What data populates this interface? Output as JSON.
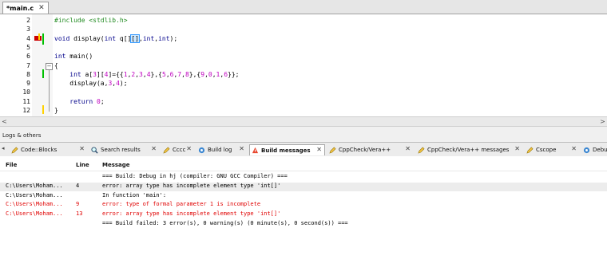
{
  "editor_tab": {
    "label": "*main.c",
    "close": "✕"
  },
  "editor": {
    "lines": [
      {
        "num": "2",
        "segments": [
          {
            "t": "#include <stdlib.h>",
            "c": "pp"
          }
        ]
      },
      {
        "num": "3",
        "segments": []
      },
      {
        "num": "4",
        "segments": [
          {
            "t": "void ",
            "c": "kw"
          },
          {
            "t": "display(",
            "c": ""
          },
          {
            "t": "int",
            "c": "kw"
          },
          {
            "t": " q[]",
            "c": ""
          },
          {
            "t": "[]",
            "c": "cb"
          },
          {
            "t": ",",
            "c": ""
          },
          {
            "t": "int",
            "c": "kw"
          },
          {
            "t": ",",
            "c": ""
          },
          {
            "t": "int",
            "c": "kw"
          },
          {
            "t": ");",
            "c": ""
          }
        ]
      },
      {
        "num": "5",
        "segments": []
      },
      {
        "num": "6",
        "segments": [
          {
            "t": "int ",
            "c": "kw"
          },
          {
            "t": "main()",
            "c": ""
          }
        ]
      },
      {
        "num": "7",
        "segments": [
          {
            "t": "{",
            "c": ""
          }
        ]
      },
      {
        "num": "8",
        "segments": [
          {
            "t": "    int ",
            "c": "kw"
          },
          {
            "t": "a[",
            "c": ""
          },
          {
            "t": "3",
            "c": "num"
          },
          {
            "t": "][",
            "c": ""
          },
          {
            "t": "4",
            "c": "num"
          },
          {
            "t": "]={{",
            "c": ""
          },
          {
            "t": "1",
            "c": "num"
          },
          {
            "t": ",",
            "c": ""
          },
          {
            "t": "2",
            "c": "num"
          },
          {
            "t": ",",
            "c": ""
          },
          {
            "t": "3",
            "c": "num"
          },
          {
            "t": ",",
            "c": ""
          },
          {
            "t": "4",
            "c": "num"
          },
          {
            "t": "},{",
            "c": ""
          },
          {
            "t": "5",
            "c": "num"
          },
          {
            "t": ",",
            "c": ""
          },
          {
            "t": "6",
            "c": "num"
          },
          {
            "t": ",",
            "c": ""
          },
          {
            "t": "7",
            "c": "num"
          },
          {
            "t": ",",
            "c": ""
          },
          {
            "t": "8",
            "c": "num"
          },
          {
            "t": "},{",
            "c": ""
          },
          {
            "t": "9",
            "c": "num"
          },
          {
            "t": ",",
            "c": ""
          },
          {
            "t": "0",
            "c": "num"
          },
          {
            "t": ",",
            "c": ""
          },
          {
            "t": "1",
            "c": "num"
          },
          {
            "t": ",",
            "c": ""
          },
          {
            "t": "6",
            "c": "num"
          },
          {
            "t": "}};",
            "c": ""
          }
        ]
      },
      {
        "num": "9",
        "segments": [
          {
            "t": "    display(a,",
            "c": ""
          },
          {
            "t": "3",
            "c": "num"
          },
          {
            "t": ",",
            "c": ""
          },
          {
            "t": "4",
            "c": "num"
          },
          {
            "t": ");",
            "c": ""
          }
        ]
      },
      {
        "num": "10",
        "segments": []
      },
      {
        "num": "11",
        "segments": [
          {
            "t": "    return ",
            "c": "kw"
          },
          {
            "t": "0",
            "c": "num"
          },
          {
            "t": ";",
            "c": ""
          }
        ]
      },
      {
        "num": "12",
        "segments": [
          {
            "t": "}",
            "c": ""
          }
        ]
      }
    ],
    "fold_symbol": "−"
  },
  "scrollbar": {
    "left": "<",
    "right": ">"
  },
  "logs": {
    "title": "Logs & others",
    "tabs_left_arrow": "◂",
    "tabs": [
      {
        "label": "Code::Blocks",
        "icon": "pencil-icon",
        "active": false
      },
      {
        "label": "Search results",
        "icon": "magnifier-icon",
        "active": false
      },
      {
        "label": "Cccc",
        "icon": "pencil-icon",
        "active": false
      },
      {
        "label": "Build log",
        "icon": "gear-icon",
        "active": false
      },
      {
        "label": "Build messages",
        "icon": "build-messages-icon",
        "active": true
      },
      {
        "label": "CppCheck/Vera++",
        "icon": "pencil-icon",
        "active": false
      },
      {
        "label": "CppCheck/Vera++ messages",
        "icon": "pencil-icon",
        "active": false
      },
      {
        "label": "Cscope",
        "icon": "pencil-icon",
        "active": false
      },
      {
        "label": "Debugger",
        "icon": "gear-icon",
        "active": false
      }
    ],
    "tab_close": "✕",
    "columns": {
      "file": "File",
      "line": "Line",
      "message": "Message"
    },
    "rows": [
      {
        "file": "",
        "line": "",
        "message": "=== Build: Debug in hj (compiler: GNU GCC Compiler) ===",
        "error": false,
        "selected": false
      },
      {
        "file": "C:\\Users\\Moham...",
        "line": "4",
        "message": "error: array type has incomplete element type 'int[]'",
        "error": false,
        "selected": true
      },
      {
        "file": "C:\\Users\\Moham...",
        "line": "",
        "message": "In function 'main':",
        "error": false,
        "selected": false
      },
      {
        "file": "C:\\Users\\Moham...",
        "line": "9",
        "message": "error: type of formal parameter 1 is incomplete",
        "error": true,
        "selected": false
      },
      {
        "file": "C:\\Users\\Moham...",
        "line": "13",
        "message": "error: array type has incomplete element type 'int[]'",
        "error": true,
        "selected": false
      },
      {
        "file": "",
        "line": "",
        "message": "=== Build failed: 3 error(s), 0 warning(s) (0 minute(s), 0 second(s)) ===",
        "error": false,
        "selected": false
      }
    ]
  }
}
